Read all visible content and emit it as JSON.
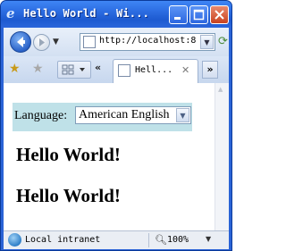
{
  "window": {
    "title": "Hello World - Wi..."
  },
  "toolbar": {
    "address": "http://localhost:8",
    "tab_label": "Hell...",
    "tab_close": "✕",
    "chevron_left": "«",
    "chevron_right": "»"
  },
  "page": {
    "language_label": "Language:",
    "language_selected": "American English",
    "heading_1": "Hello World!",
    "heading_2": "Hello World!"
  },
  "statusbar": {
    "zone": "Local intranet",
    "zoom": "100%"
  },
  "colors": {
    "titlebar": "#2e6fe4",
    "language_panel": "#bfe1e8",
    "page_background": "#ffffff"
  },
  "icons": [
    "ie-logo-icon",
    "minimize-icon",
    "maximize-icon",
    "close-icon",
    "back-icon",
    "forward-icon",
    "refresh-icon",
    "favorites-star-icon",
    "add-favorites-icon",
    "quick-tabs-icon",
    "page-icon",
    "globe-icon",
    "zoom-icon"
  ]
}
